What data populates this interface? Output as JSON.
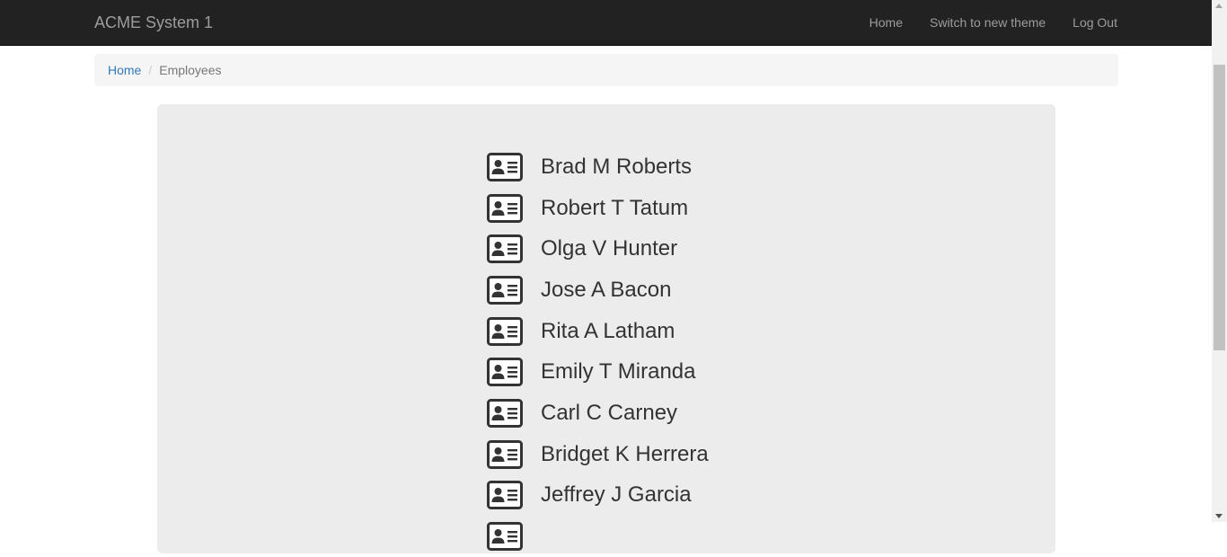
{
  "navbar": {
    "brand": "ACME System 1",
    "links": [
      {
        "label": "Home"
      },
      {
        "label": "Switch to new theme"
      },
      {
        "label": "Log Out"
      }
    ]
  },
  "breadcrumb": {
    "home": "Home",
    "separator": "/",
    "current": "Employees"
  },
  "employees": [
    {
      "name": "Brad M Roberts",
      "icon": "id-card-icon"
    },
    {
      "name": "Robert T Tatum",
      "icon": "id-card-icon"
    },
    {
      "name": "Olga V Hunter",
      "icon": "id-card-icon"
    },
    {
      "name": "Jose A Bacon",
      "icon": "id-card-icon"
    },
    {
      "name": "Rita A Latham",
      "icon": "id-card-icon"
    },
    {
      "name": "Emily T Miranda",
      "icon": "id-card-icon"
    },
    {
      "name": "Carl C Carney",
      "icon": "id-card-icon"
    },
    {
      "name": "Bridget K Herrera",
      "icon": "id-card-icon"
    },
    {
      "name": "Jeffrey J Garcia",
      "icon": "id-card-icon"
    },
    {
      "name": "",
      "icon": "id-card-icon"
    }
  ],
  "colors": {
    "navbar_bg": "#222222",
    "nav_text": "#9d9d9d",
    "link": "#337ab7",
    "panel_bg": "#ececec",
    "text": "#333333"
  }
}
